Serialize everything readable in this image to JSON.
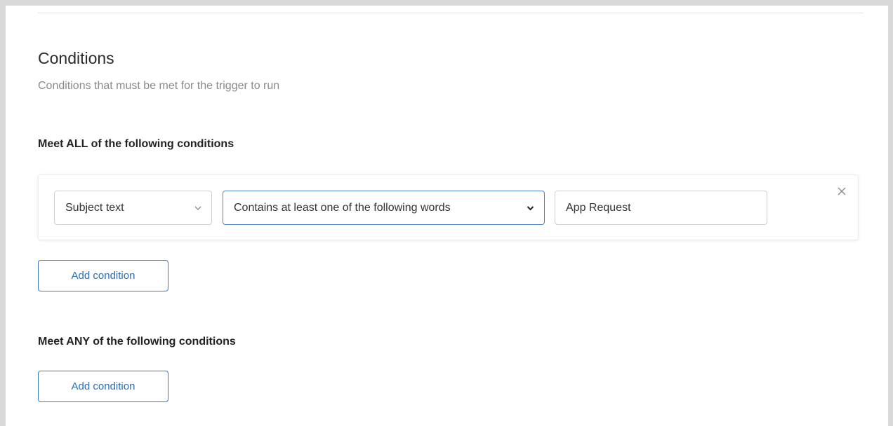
{
  "header": {
    "title": "Conditions",
    "subtitle": "Conditions that must be met for the trigger to run"
  },
  "all_group": {
    "title": "Meet ALL of the following conditions",
    "conditions": [
      {
        "field": "Subject text",
        "operator": "Contains at least one of the following words",
        "value": "App Request"
      }
    ],
    "add_label": "Add condition"
  },
  "any_group": {
    "title": "Meet ANY of the following conditions",
    "add_label": "Add condition"
  },
  "colors": {
    "accent": "#3a7cc2",
    "focus_border": "#4b86c8",
    "muted_text": "#8a8a8a"
  },
  "icons": {
    "field_dropdown": "chevron-down-icon",
    "operator_dropdown": "chevron-down-icon",
    "remove": "close-icon"
  }
}
